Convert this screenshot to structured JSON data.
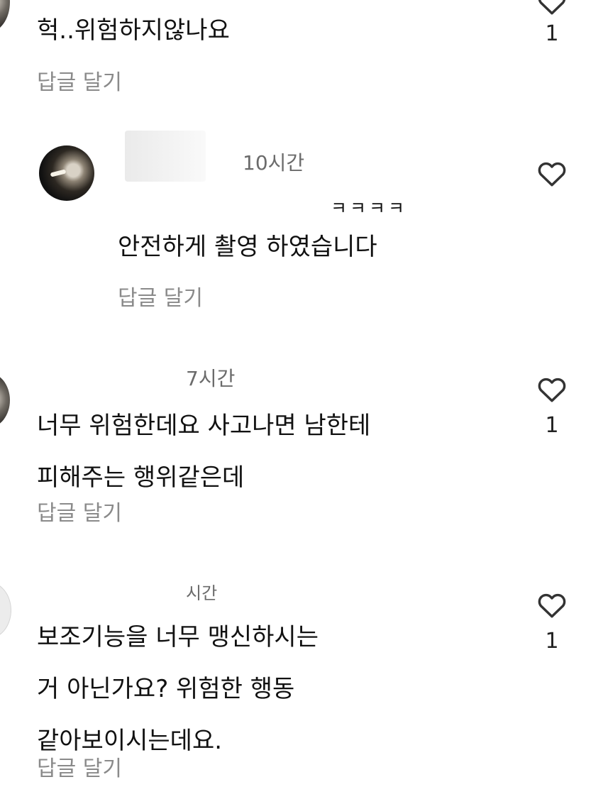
{
  "comments": [
    {
      "text_lines": [
        "헉..위험하지않나요"
      ],
      "reply_label": "답글 달기",
      "like_count": "1",
      "icon": "heart-outline-icon"
    },
    {
      "time": "10시간",
      "mention": "ㅋㅋㅋㅋ",
      "text_lines": [
        "안전하게 촬영 하였습니다"
      ],
      "reply_label": "답글 달기",
      "icon": "heart-outline-icon"
    },
    {
      "time": "7시간",
      "text_lines": [
        "너무 위험한데요 사고나면 남한테",
        "피해주는 행위같은데"
      ],
      "reply_label": "답글 달기",
      "like_count": "1",
      "icon": "heart-outline-icon"
    },
    {
      "time": "시간",
      "text_lines": [
        "보조기능을 너무 맹신하시는",
        "거 아닌가요? 위험한 행동",
        "같아보이시는데요."
      ],
      "reply_label": "답글 달기",
      "like_count": "1",
      "icon": "heart-outline-icon"
    }
  ],
  "colors": {
    "text": "#111111",
    "muted": "#8a8a8a",
    "time": "#6b6b6b",
    "background": "#ffffff"
  }
}
